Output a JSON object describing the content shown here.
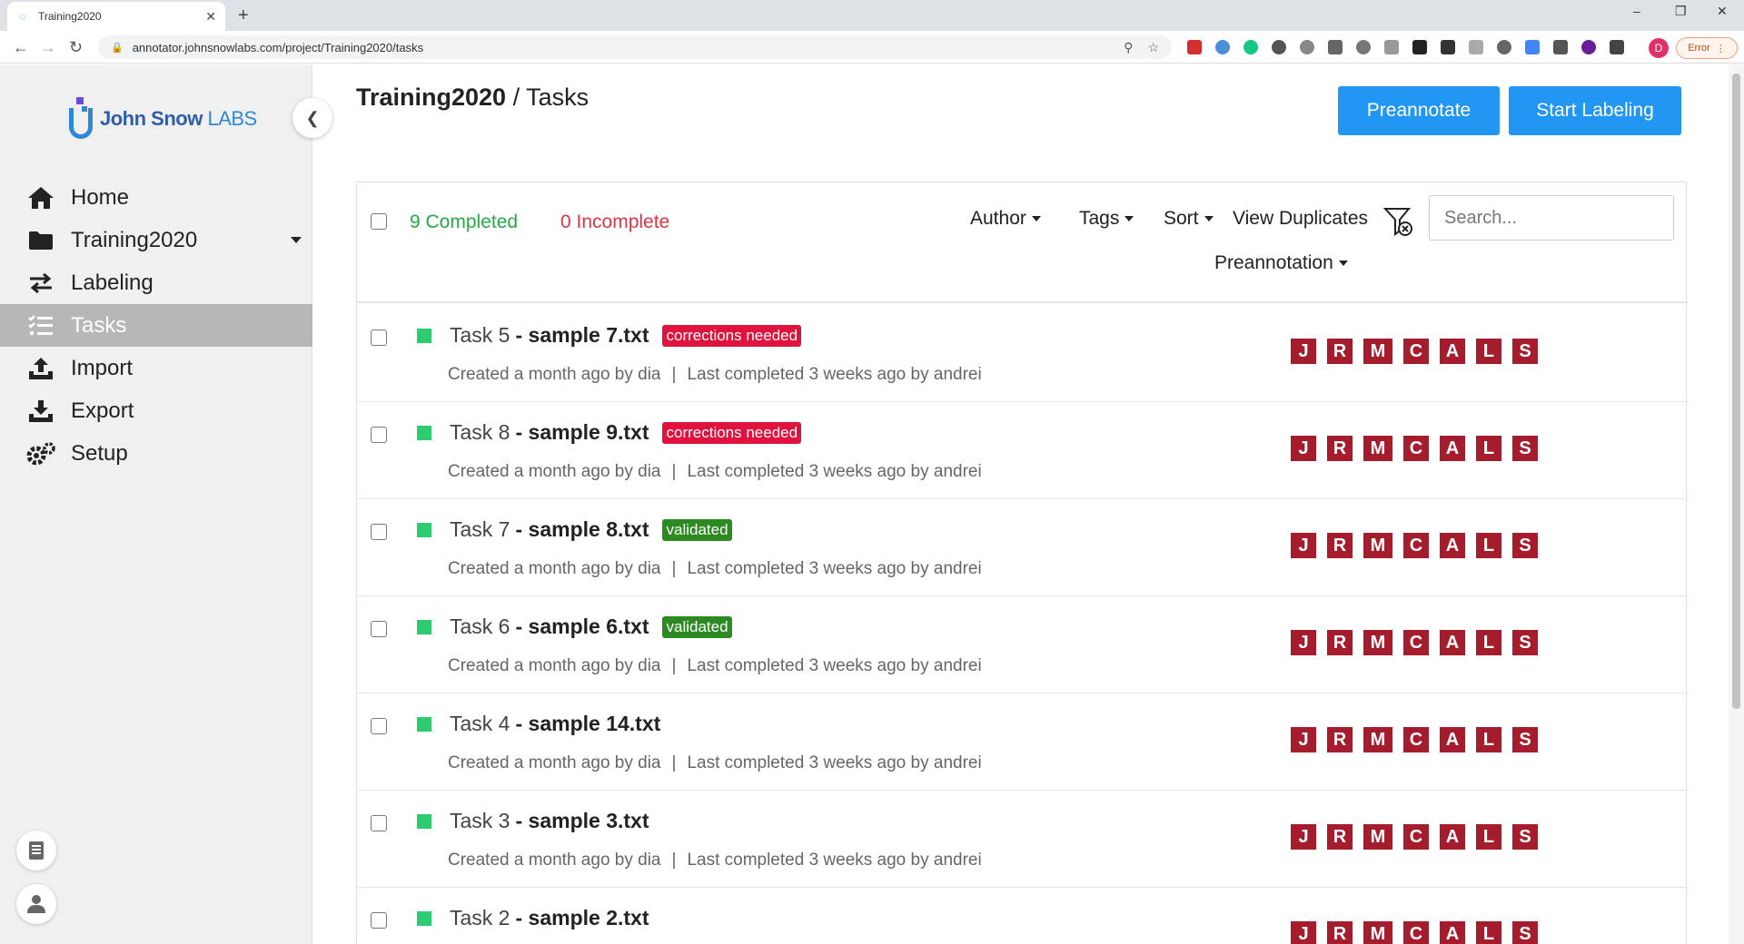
{
  "browser": {
    "tab_title": "Training2020",
    "url": "annotator.johnsnowlabs.com/project/Training2020/tasks",
    "profile_initial": "D",
    "error_label": "Error"
  },
  "sidebar": {
    "logo_name": "John Snow",
    "logo_labs": "LABS",
    "items": [
      {
        "label": "Home",
        "icon": "home-icon"
      },
      {
        "label": "Training2020",
        "icon": "folder-icon"
      },
      {
        "label": "Labeling",
        "icon": "swap-icon"
      },
      {
        "label": "Tasks",
        "icon": "list-icon"
      },
      {
        "label": "Import",
        "icon": "upload-icon"
      },
      {
        "label": "Export",
        "icon": "download-icon"
      },
      {
        "label": "Setup",
        "icon": "gear-icon"
      }
    ],
    "active": "Tasks"
  },
  "header": {
    "project": "Training2020",
    "separator": "/",
    "page": "Tasks",
    "preannotate_label": "Preannotate",
    "start_labeling_label": "Start Labeling"
  },
  "toolbar": {
    "completed": "9 Completed",
    "incomplete": "0 Incomplete",
    "author": "Author",
    "tags": "Tags",
    "sort": "Sort",
    "view_duplicates": "View Duplicates",
    "preannotation": "Preannotation",
    "search_placeholder": "Search..."
  },
  "avatar_letters": [
    "J",
    "R",
    "M",
    "C",
    "A",
    "L",
    "S"
  ],
  "tasks": [
    {
      "id": "Task 5",
      "file": "- sample 7.txt",
      "tag": "corrections needed",
      "tag_type": "corrections",
      "created": "Created a month ago by dia",
      "completed": "Last completed 3 weeks ago by andrei"
    },
    {
      "id": "Task 8",
      "file": "- sample 9.txt",
      "tag": "corrections needed",
      "tag_type": "corrections",
      "created": "Created a month ago by dia",
      "completed": "Last completed 3 weeks ago by andrei"
    },
    {
      "id": "Task 7",
      "file": "- sample 8.txt",
      "tag": "validated",
      "tag_type": "validated",
      "created": "Created a month ago by dia",
      "completed": "Last completed 3 weeks ago by andrei"
    },
    {
      "id": "Task 6",
      "file": "- sample 6.txt",
      "tag": "validated",
      "tag_type": "validated",
      "created": "Created a month ago by dia",
      "completed": "Last completed 3 weeks ago by andrei"
    },
    {
      "id": "Task 4",
      "file": "- sample 14.txt",
      "tag": "",
      "tag_type": "",
      "created": "Created a month ago by dia",
      "completed": "Last completed 3 weeks ago by andrei"
    },
    {
      "id": "Task 3",
      "file": "- sample 3.txt",
      "tag": "",
      "tag_type": "",
      "created": "Created a month ago by dia",
      "completed": "Last completed 3 weeks ago by andrei"
    },
    {
      "id": "Task 2",
      "file": "- sample 2.txt",
      "tag": "",
      "tag_type": "",
      "created": "",
      "completed": ""
    }
  ],
  "colors": {
    "primary": "#2196f3",
    "completed": "#28a745",
    "incomplete": "#dc3545",
    "tag_corrections": "#e0123e",
    "tag_validated": "#2d8a22",
    "avatar_bg": "#a51d2d",
    "status_done": "#2ecc71"
  }
}
